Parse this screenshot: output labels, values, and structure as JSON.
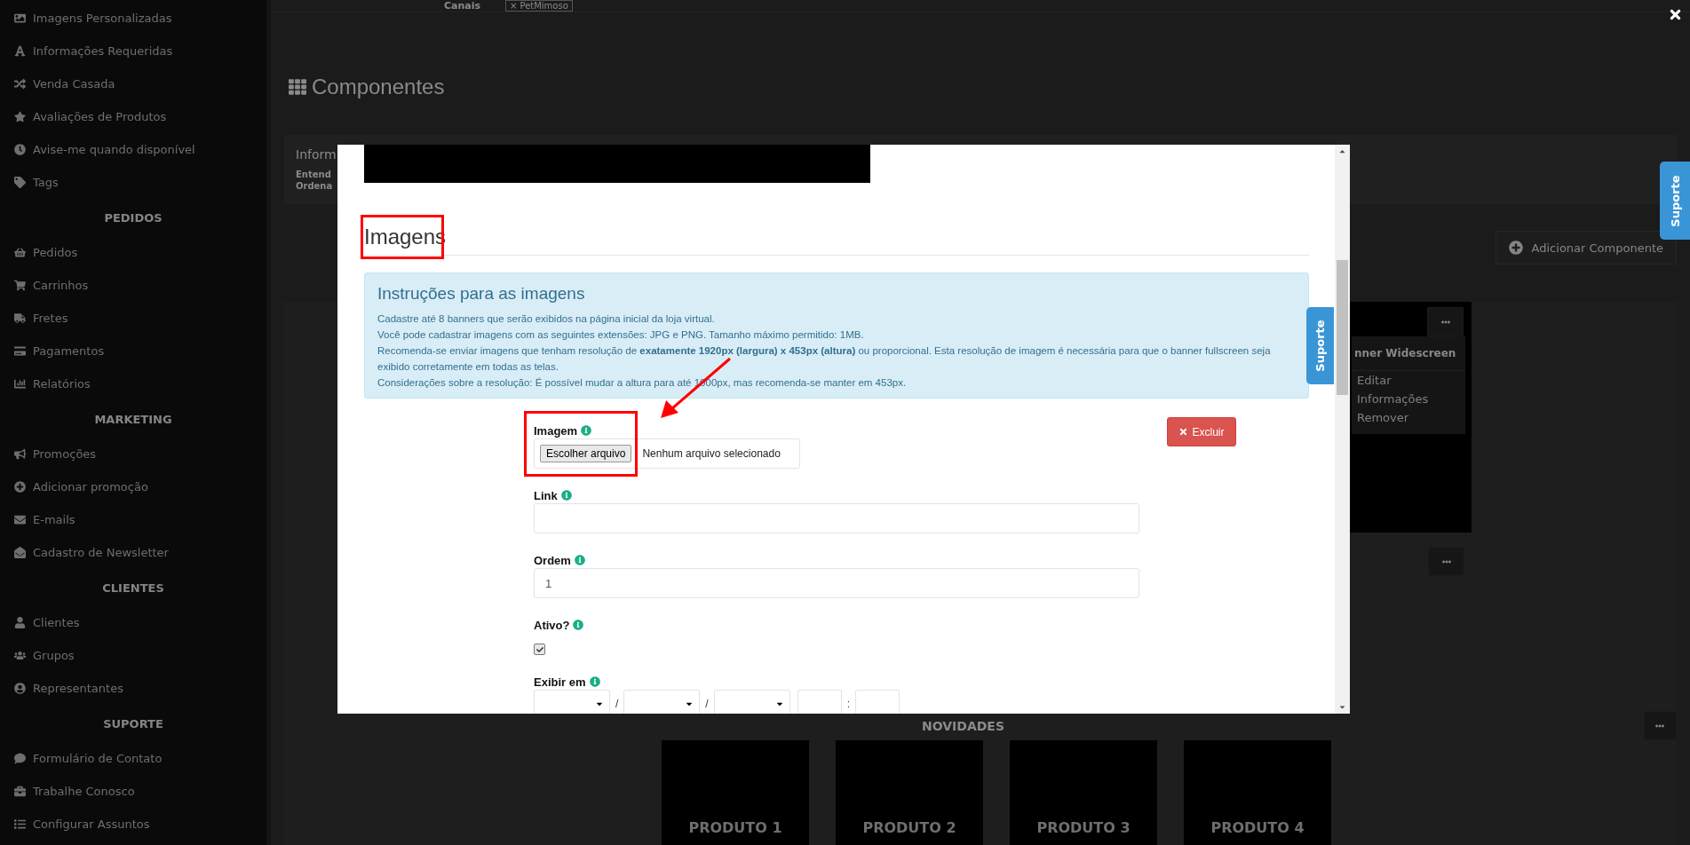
{
  "sidebar": {
    "sections": [
      {
        "items": [
          "Imagens Personalizadas",
          "Informações Requeridas",
          "Venda Casada",
          "Avaliações de Produtos",
          "Avise-me quando disponível",
          "Tags"
        ]
      },
      {
        "heading": "PEDIDOS",
        "items": [
          "Pedidos",
          "Carrinhos",
          "Fretes",
          "Pagamentos",
          "Relatórios"
        ]
      },
      {
        "heading": "MARKETING",
        "items": [
          "Promoções",
          "Adicionar promoção",
          "E-mails",
          "Cadastro de Newsletter"
        ]
      },
      {
        "heading": "CLIENTES",
        "items": [
          "Clientes",
          "Grupos",
          "Representantes"
        ]
      },
      {
        "heading": "SUPORTE",
        "items": [
          "Formulário de Contato",
          "Trabalhe Conosco",
          "Configurar Assuntos"
        ]
      }
    ]
  },
  "channels": {
    "label": "Canais",
    "chip_remove": "×",
    "chip": "PetMimoso"
  },
  "page_title": "Componentes",
  "info_panel": {
    "title": "Inform",
    "lines": [
      "Entend",
      "Ordena"
    ]
  },
  "add_component_button": "Adicionar Componente",
  "component_menu": {
    "title": "nner Widescreen",
    "items": [
      "Editar",
      "Informações",
      "Remover"
    ]
  },
  "section_title": "NOVIDADES",
  "products": [
    "PRODUTO 1",
    "PRODUTO 2",
    "PRODUTO 3",
    "PRODUTO 4"
  ],
  "support_tab": "Suporte",
  "modal": {
    "section_heading": "Imagens",
    "instructions": {
      "title": "Instruções para as imagens",
      "lines": [
        "Cadastre até 8 banners que serão exibidos na página inicial da loja virtual.",
        "Você pode cadastrar imagens com as seguintes extensões: JPG e PNG. Tamanho máximo permitido: 1MB.",
        "Recomenda-se enviar imagens que tenham resolução de **exatamente 1920px (largura) x 453px (altura)** ou proporcional. Esta resolução de imagem é necessária para que o banner fullscreen seja exibido corretamente em todas as telas.",
        "Considerações sobre a resolução: É possível mudar a altura para até 1000px, mas recomenda-se manter em 453px."
      ]
    },
    "fields": [
      {
        "kind": "file",
        "label": "Imagem",
        "button": "Escolher arquivo",
        "status": "Nenhum arquivo selecionado"
      },
      {
        "kind": "text",
        "label": "Link"
      },
      {
        "kind": "text",
        "label": "Ordem",
        "value": "1"
      },
      {
        "kind": "checkbox",
        "label": "Ativo?",
        "checked": true
      },
      {
        "kind": "datetime",
        "label": "Exibir em",
        "separators": [
          "/",
          "/",
          ":"
        ]
      }
    ],
    "delete_button": "Excluir",
    "support_tab": "Suporte"
  }
}
